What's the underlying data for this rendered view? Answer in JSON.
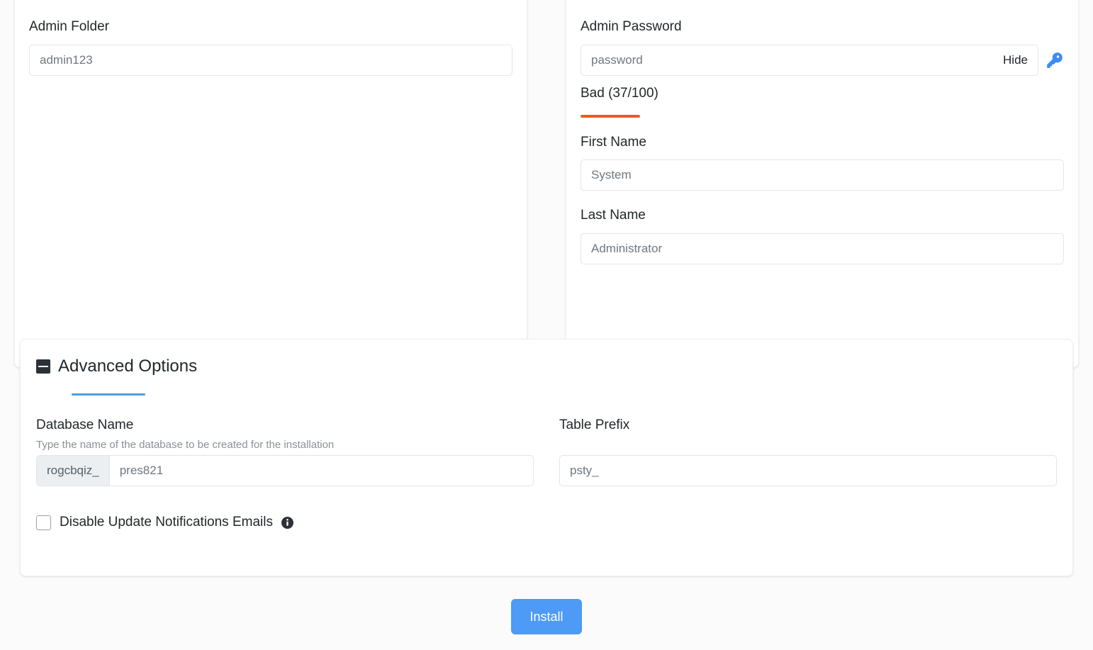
{
  "left_card": {
    "admin_folder": {
      "label": "Admin Folder",
      "value": "admin123",
      "placeholder": "admin123"
    }
  },
  "right_card": {
    "admin_password": {
      "label": "Admin Password",
      "value": "password",
      "placeholder": "password",
      "toggle_label": "Hide",
      "key_icon": "key-icon"
    },
    "strength": {
      "text": "Bad (37/100)",
      "score": 37,
      "max": 100,
      "color": "#f1581f"
    },
    "first_name": {
      "label": "First Name",
      "value": "System",
      "placeholder": "System"
    },
    "last_name": {
      "label": "Last Name",
      "value": "Administrator",
      "placeholder": "Administrator"
    }
  },
  "advanced": {
    "title": "Advanced Options",
    "collapse_icon": "minus-square-icon",
    "accent_color": "#4a9fe0",
    "database_name": {
      "label": "Database Name",
      "help": "Type the name of the database to be created for the installation",
      "prefix": "rogcbqiz_",
      "value": "pres821",
      "placeholder": "pres821"
    },
    "table_prefix": {
      "label": "Table Prefix",
      "value": "psty_",
      "placeholder": "psty_"
    },
    "disable_updates": {
      "label": "Disable Update Notifications Emails",
      "checked": false,
      "info_icon": "info-icon"
    }
  },
  "footer": {
    "install_label": "Install",
    "install_color": "#4d9af7"
  }
}
